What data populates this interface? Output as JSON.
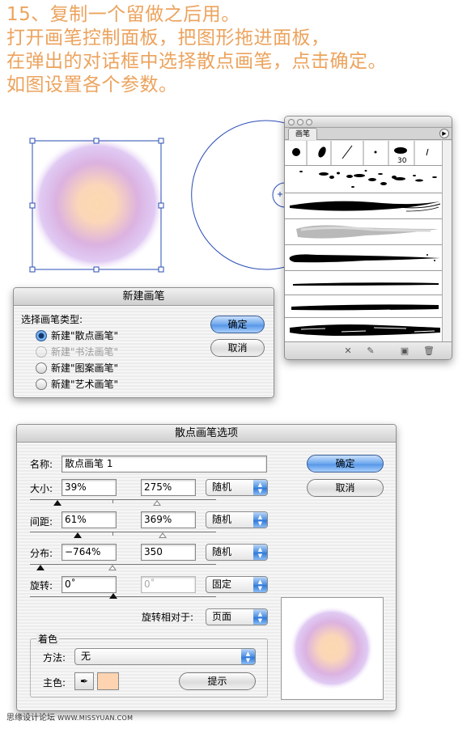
{
  "heading": {
    "lines": [
      "15、复制一个留做之后用。",
      "打开画笔控制面板，把图形拖进面板，",
      "在弹出的对话框中选择散点画笔，点击确定。",
      "如图设置各个参数。"
    ]
  },
  "brush_panel": {
    "tab_label": "画笔",
    "menu_icon": "triangle-right-icon",
    "sample_size_label": "30",
    "footer_icons": [
      "remove-stroke-icon",
      "brush-options-icon",
      "new-brush-icon",
      "delete-brush-icon"
    ]
  },
  "new_brush_dialog": {
    "title": "新建画笔",
    "prompt": "选择画笔类型:",
    "options": [
      {
        "label": "新建\"散点画笔\"",
        "selected": true,
        "enabled": true
      },
      {
        "label": "新建\"书法画笔\"",
        "selected": false,
        "enabled": false
      },
      {
        "label": "新建\"图案画笔\"",
        "selected": false,
        "enabled": true
      },
      {
        "label": "新建\"艺术画笔\"",
        "selected": false,
        "enabled": true
      }
    ],
    "ok_label": "确定",
    "cancel_label": "取消"
  },
  "scatter_dialog": {
    "title": "散点画笔选项",
    "name_label": "名称:",
    "name_value": "散点画笔 1",
    "size_label": "大小:",
    "size_min": "39%",
    "size_max": "275%",
    "size_mode": "随机",
    "spacing_label": "间距:",
    "spacing_min": "61%",
    "spacing_max": "369%",
    "spacing_mode": "随机",
    "scatter_label": "分布:",
    "scatter_min": "−764%",
    "scatter_max": "350",
    "scatter_mode": "随机",
    "rotation_label": "旋转:",
    "rotation_value": "0˚",
    "rotation_value2": "0˚",
    "rotation_mode": "固定",
    "rotation_relative_label": "旋转相对于:",
    "rotation_relative_value": "页面",
    "colorize_group_label": "着色",
    "method_label": "方法:",
    "method_value": "无",
    "key_color_label": "主色:",
    "key_color": "#fdd3b0",
    "tips_label": "提示",
    "ok_label": "确定",
    "cancel_label": "取消"
  },
  "colors": {
    "heading": "#eca35d",
    "selection_blue": "#2a4db5",
    "gradient_center": "#fdd9b0",
    "gradient_outer": "#c7a2ea"
  },
  "watermark": {
    "text": "思缘设计论坛",
    "url": "WWW.MISSYUAN.COM"
  }
}
